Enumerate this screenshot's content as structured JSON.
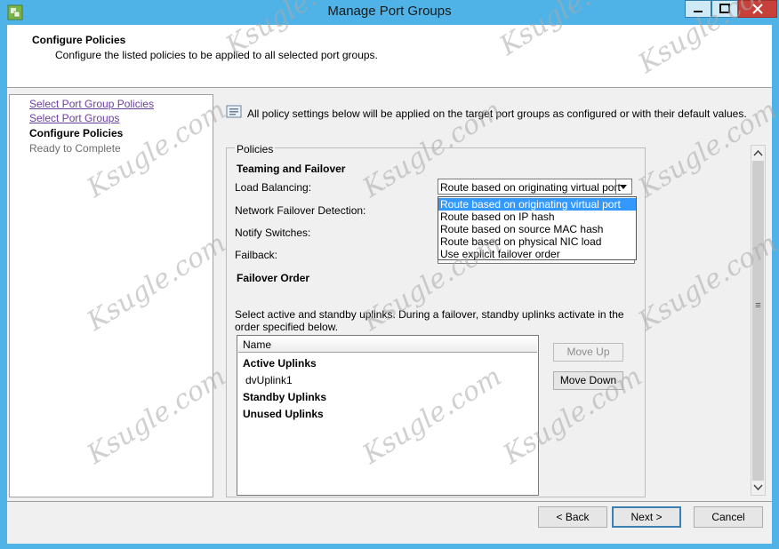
{
  "window": {
    "title": "Manage Port Groups",
    "min_glyph": "—",
    "max_glyph": "□",
    "close_glyph": "✕"
  },
  "header": {
    "title": "Configure Policies",
    "description": "Configure the listed policies to be applied to all selected port groups."
  },
  "nav": {
    "items": [
      {
        "label": "Select Port Group Policies"
      },
      {
        "label": "Select Port Groups"
      },
      {
        "label": "Configure Policies"
      },
      {
        "label": "Ready to Complete"
      }
    ]
  },
  "info": {
    "text": "All policy settings below will be applied on the target port groups as configured or with their default values."
  },
  "policies": {
    "legend": "Policies",
    "teaming_title": "Teaming and Failover",
    "load_balancing_label": "Load Balancing:",
    "network_failover_label": "Network Failover Detection:",
    "notify_switches_label": "Notify Switches:",
    "failback_label": "Failback:",
    "load_balancing_value": "Route based on originating virtual port",
    "dropdown_options": [
      "Route based on originating virtual port",
      "Route based on IP hash",
      "Route based on source MAC hash",
      "Route based on physical NIC load",
      "Use explicit failover order"
    ],
    "failover_order_title": "Failover Order",
    "uplinks_description": "Select active and standby uplinks. During a failover, standby uplinks activate in the order specified below.",
    "list": {
      "column_name": "Name",
      "active_group": "Active Uplinks",
      "active_item": "dvUplink1",
      "standby_group": "Standby Uplinks",
      "unused_group": "Unused Uplinks"
    },
    "move_up_label": "Move Up",
    "move_down_label": "Move Down"
  },
  "footer": {
    "back_label": "< Back",
    "next_label": "Next >",
    "cancel_label": "Cancel"
  },
  "watermark": {
    "text": "Ksugle.com"
  },
  "colors": {
    "title_bar": "#4fb3e8",
    "selection": "#3399ff",
    "link": "#6b3fa0",
    "close_button": "#c7413a"
  },
  "icons": {
    "app": "port-group-app-icon",
    "info": "info-icon",
    "dropdown": "chevron-down-icon",
    "scroll_up": "chevron-up-icon",
    "scroll_down": "chevron-down-icon"
  }
}
